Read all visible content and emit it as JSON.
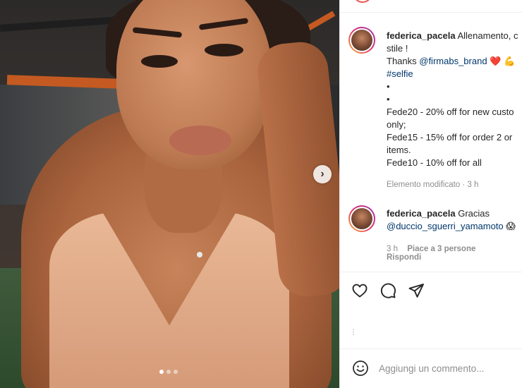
{
  "post": {
    "image_description_icons": [
      "chevron-right-icon"
    ],
    "carousel": {
      "total": 3,
      "current": 1
    }
  },
  "caption": {
    "username": "federica_pacela",
    "line1": "Allenamento, c",
    "line2": "stile !",
    "thanks": "Thanks ",
    "mention": "@firmabs_brand",
    "emojis": "❤️ 💪",
    "hashtag": "#selfie",
    "bullet1": "•",
    "bullet2": "•",
    "promo1a": "Fede20 - 20% off for new custo",
    "promo1b": "only;",
    "promo2a": "Fede15 - 15% off for order 2 or",
    "promo2b": "items.",
    "promo3": "Fede10 - 10% off for all",
    "meta": "Elemento modificato · 3 h"
  },
  "reply": {
    "username": "federica_pacela",
    "text": "Gracias",
    "mention": "@duccio_sguerri_yamamoto",
    "emoji": "😱",
    "time": "3 h",
    "likes": "Piace a 3 persone",
    "reply_label": "Rispondi"
  },
  "actions": {
    "icons": [
      "heart-icon",
      "comment-icon",
      "share-icon"
    ],
    "dots": "⋮"
  },
  "comment_box": {
    "placeholder": "Aggiungi un commento..."
  }
}
